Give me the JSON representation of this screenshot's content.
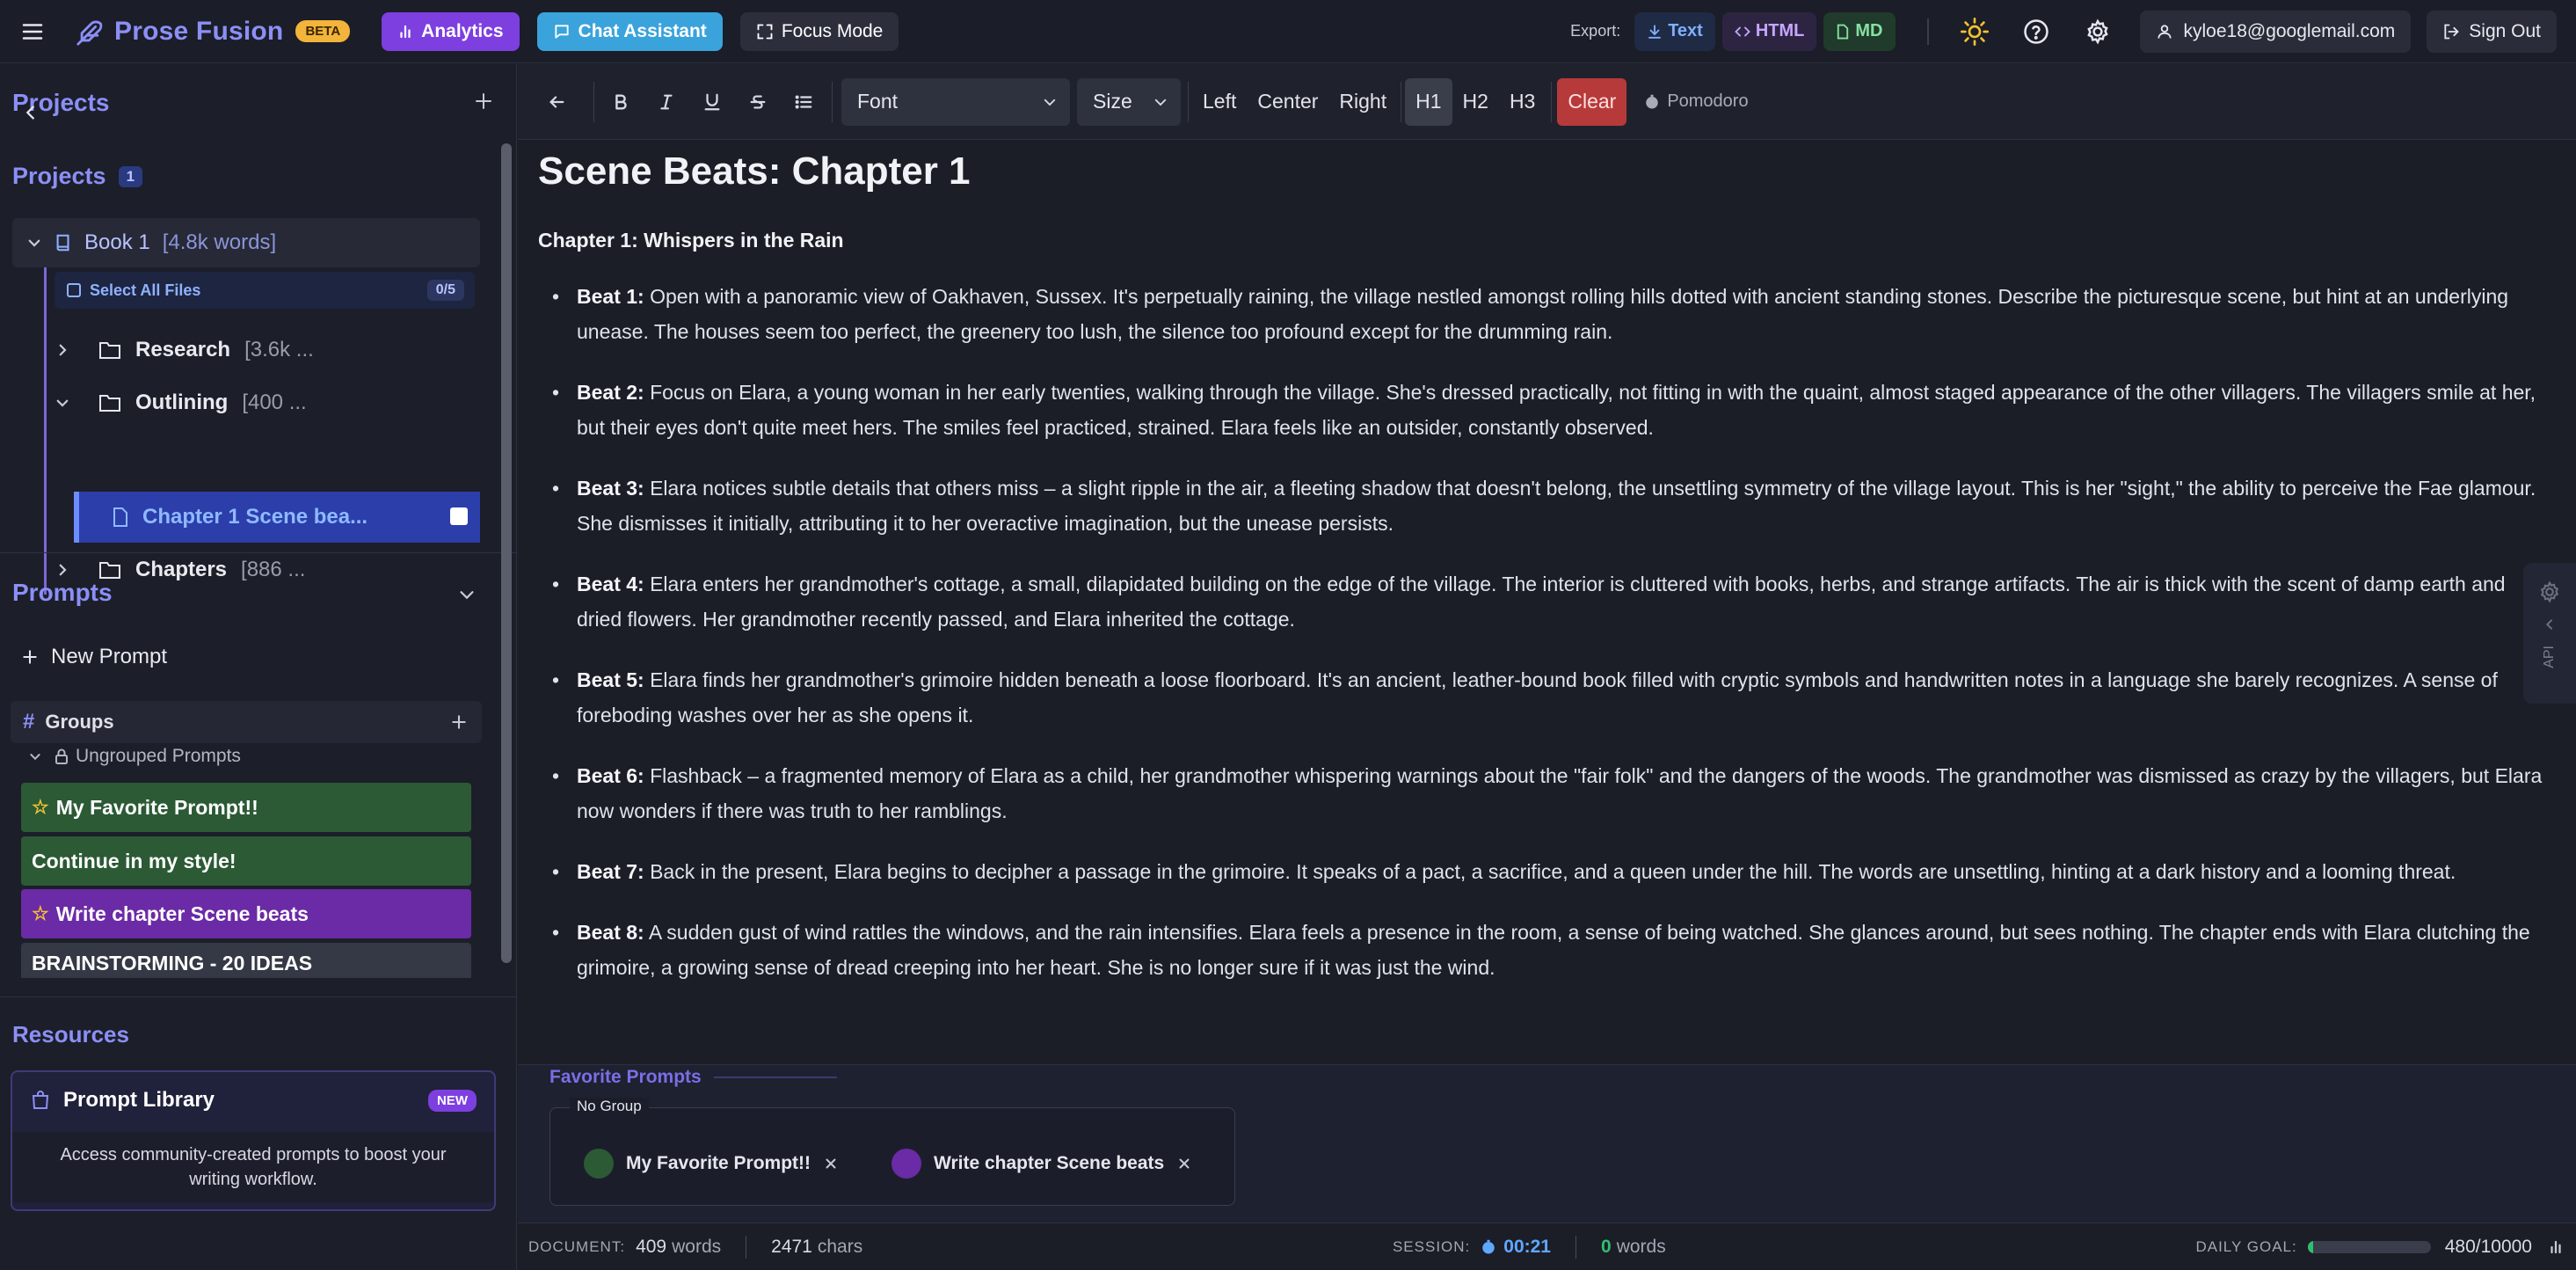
{
  "app": {
    "name": "Prose Fusion",
    "badge": "BETA",
    "analytics_label": "Analytics",
    "chat_label": "Chat Assistant",
    "focus_label": "Focus Mode",
    "export_label": "Export:",
    "export_text": "Text",
    "export_html": "HTML",
    "export_md": "MD",
    "user_email": "kyloe18@googlemail.com",
    "signout_label": "Sign Out",
    "colors": {
      "accent": "#8b8ff5",
      "analytics": "#7d3fe0",
      "chat": "#3aa3db",
      "clear": "#b73a3a"
    }
  },
  "sidebar": {
    "projects_header": "Projects",
    "projects_label": "Projects",
    "projects_count": "1",
    "book": {
      "name": "Book 1",
      "words": "[4.8k words]"
    },
    "select_all_label": "Select All Files",
    "select_count": "0/5",
    "folders": [
      {
        "name": "Research",
        "meta": "[3.6k ..."
      },
      {
        "name": "Outlining",
        "meta": "[400 ..."
      },
      {
        "name": "Chapters",
        "meta": "[886 ..."
      }
    ],
    "selected_file": "Chapter 1 Scene bea...",
    "prompts_header": "Prompts",
    "new_prompt_label": "New Prompt",
    "groups_label": "Groups",
    "ungrouped_label": "Ungrouped Prompts",
    "prompt_items": [
      {
        "label": "My Favorite Prompt!!",
        "starred": true
      },
      {
        "label": "Continue in my style!",
        "starred": false
      },
      {
        "label": "Write chapter Scene beats",
        "starred": true
      },
      {
        "label": "BRAINSTORMING - 20 IDEAS",
        "starred": false
      }
    ],
    "resources_header": "Resources",
    "library": {
      "title": "Prompt Library",
      "badge": "NEW",
      "description": "Access community-created prompts to boost your writing workflow."
    }
  },
  "toolbar": {
    "font_select": "Font",
    "size_select": "Size",
    "align_left": "Left",
    "align_center": "Center",
    "align_right": "Right",
    "h1": "H1",
    "h2": "H2",
    "h3": "H3",
    "clear": "Clear",
    "pomodoro": "Pomodoro"
  },
  "document": {
    "title": "Scene Beats: Chapter 1",
    "subtitle": "Chapter 1: Whispers in the Rain",
    "beats": [
      {
        "label": "Beat 1:",
        "text": " Open with a panoramic view of Oakhaven, Sussex. It's perpetually raining, the village nestled amongst rolling hills dotted with ancient standing stones. Describe the picturesque scene, but hint at an underlying unease. The houses seem too perfect, the greenery too lush, the silence too profound except for the drumming rain."
      },
      {
        "label": "Beat 2:",
        "text": " Focus on Elara, a young woman in her early twenties, walking through the village. She's dressed practically, not fitting in with the quaint, almost staged appearance of the other villagers. The villagers smile at her, but their eyes don't quite meet hers. The smiles feel practiced, strained. Elara feels like an outsider, constantly observed."
      },
      {
        "label": "Beat 3:",
        "text": " Elara notices subtle details that others miss – a slight ripple in the air, a fleeting shadow that doesn't belong, the unsettling symmetry of the village layout. This is her \"sight,\" the ability to perceive the Fae glamour. She dismisses it initially, attributing it to her overactive imagination, but the unease persists."
      },
      {
        "label": "Beat 4:",
        "text": " Elara enters her grandmother's cottage, a small, dilapidated building on the edge of the village. The interior is cluttered with books, herbs, and strange artifacts. The air is thick with the scent of damp earth and dried flowers. Her grandmother recently passed, and Elara inherited the cottage."
      },
      {
        "label": "Beat 5:",
        "text": " Elara finds her grandmother's grimoire hidden beneath a loose floorboard. It's an ancient, leather-bound book filled with cryptic symbols and handwritten notes in a language she barely recognizes. A sense of foreboding washes over her as she opens it."
      },
      {
        "label": "Beat 6:",
        "text": " Flashback – a fragmented memory of Elara as a child, her grandmother whispering warnings about the \"fair folk\" and the dangers of the woods. The grandmother was dismissed as crazy by the villagers, but Elara now wonders if there was truth to her ramblings."
      },
      {
        "label": "Beat 7:",
        "text": " Back in the present, Elara begins to decipher a passage in the grimoire. It speaks of a pact, a sacrifice, and a queen under the hill. The words are unsettling, hinting at a dark history and a looming threat."
      },
      {
        "label": "Beat 8:",
        "text": " A sudden gust of wind rattles the windows, and the rain intensifies. Elara feels a presence in the room, a sense of being watched. She glances around, but sees nothing. The chapter ends with Elara clutching the grimoire, a growing sense of dread creeping into her heart. She is no longer sure if it was just the wind."
      }
    ]
  },
  "api_tab_label": "API",
  "favorites": {
    "title": "Favorite Prompts",
    "group_label": "No Group",
    "chips": [
      {
        "label": "My Favorite Prompt!!",
        "color": "#2b5a35"
      },
      {
        "label": "Write chapter Scene beats",
        "color": "#6b2aa6"
      }
    ]
  },
  "status": {
    "document_label": "DOCUMENT:",
    "words_value": "409",
    "words_unit": "words",
    "chars_value": "2471",
    "chars_unit": "chars",
    "session_label": "SESSION:",
    "session_time": "00:21",
    "session_words": "0",
    "session_words_unit": "words",
    "goal_label": "DAILY GOAL:",
    "goal_value": "480/10000",
    "goal_fraction": 0.048
  }
}
